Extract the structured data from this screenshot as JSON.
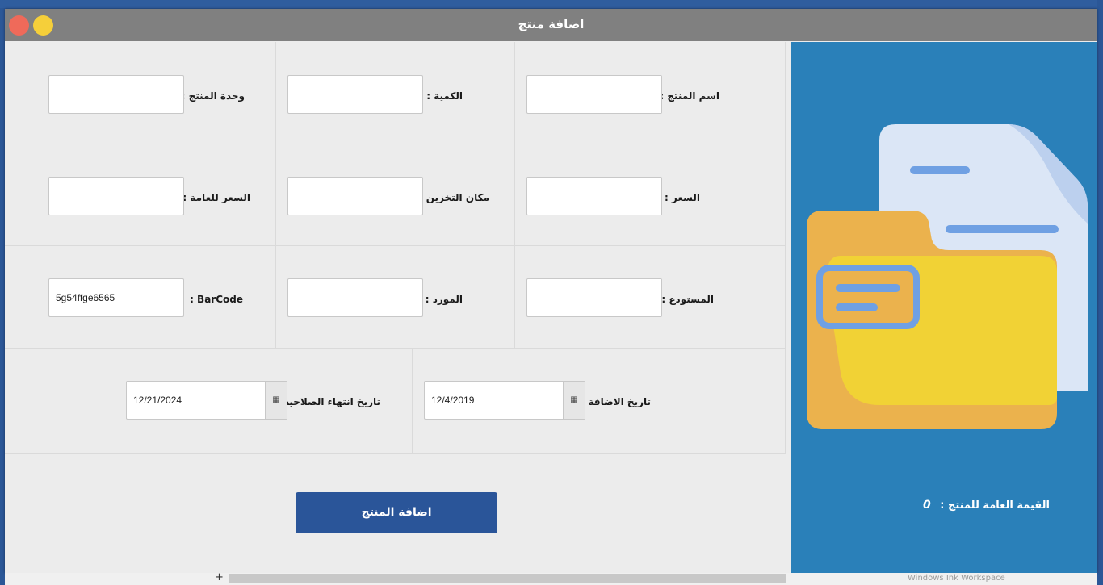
{
  "window": {
    "title": "اضافة منتج"
  },
  "form": {
    "product_name": {
      "label": "اسم المنتج :",
      "value": ""
    },
    "quantity": {
      "label": "الكمية :",
      "value": ""
    },
    "unit": {
      "label": "وحدة المنتج :",
      "value": ""
    },
    "price": {
      "label": "السعر :",
      "value": ""
    },
    "storage_location": {
      "label": "مكان التخزين :",
      "value": ""
    },
    "public_price": {
      "label": "السعر للعامة :",
      "value": ""
    },
    "warehouse": {
      "label": "المستودع :",
      "value": ""
    },
    "supplier": {
      "label": "المورد :",
      "value": ""
    },
    "barcode": {
      "label": "BarCode :",
      "value": "5g54ffge6565"
    },
    "add_date": {
      "label": "تاريخ الاضافة :",
      "value": "12/4/2019"
    },
    "expiry_date": {
      "label": "تاريخ انتهاء الصلاحية :",
      "value": "12/21/2024"
    },
    "submit_label": "اضافة المنتج"
  },
  "side_panel": {
    "total_label": "القيمة العامة للمنتج :",
    "total_value": "0"
  },
  "statusbar": {
    "plus": "+",
    "taskbar_text": "Windows Ink Workspace"
  },
  "colors": {
    "accent": "#2a5599",
    "side_panel": "#2a80b9",
    "titlebar": "#808080",
    "close": "#ef6a5a",
    "minimize": "#f5cf3a"
  }
}
